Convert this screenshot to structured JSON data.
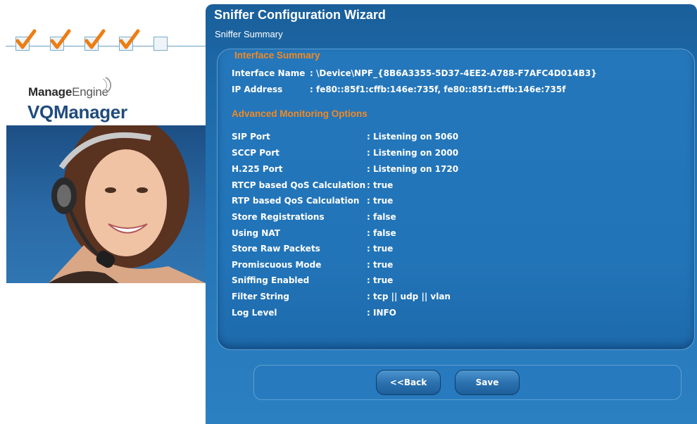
{
  "wizard": {
    "title": "Sniffer Configuration Wizard",
    "subtitle": "Sniffer Summary",
    "steps": [
      {
        "state": "completed",
        "icon": "checkmark-icon"
      },
      {
        "state": "completed",
        "icon": "checkmark-icon"
      },
      {
        "state": "completed",
        "icon": "checkmark-icon"
      },
      {
        "state": "completed",
        "icon": "checkmark-icon"
      },
      {
        "state": "current",
        "icon": "empty-box-icon"
      }
    ]
  },
  "brand": {
    "company_bold": "Manage",
    "company_light": "Engine",
    "product": "VQManager"
  },
  "interface_summary": {
    "heading": "Interface Summary",
    "rows": [
      {
        "label": "Interface Name",
        "value": ": \\Device\\NPF_{8B6A3355-5D37-4EE2-A788-F7AFC4D014B3}"
      },
      {
        "label": "IP Address",
        "value": ": fe80::85f1:cffb:146e:735f, fe80::85f1:cffb:146e:735f"
      }
    ]
  },
  "advanced_options": {
    "heading": "Advanced Monitoring Options",
    "rows": [
      {
        "label": "SIP Port",
        "value": ": Listening on 5060"
      },
      {
        "label": "SCCP Port",
        "value": ": Listening on 2000"
      },
      {
        "label": "H.225 Port",
        "value": ": Listening on 1720"
      },
      {
        "label": "RTCP based QoS Calculation",
        "value": ": true"
      },
      {
        "label": "RTP based QoS Calculation",
        "value": ": true"
      },
      {
        "label": "Store Registrations",
        "value": ": false"
      },
      {
        "label": "Using NAT",
        "value": ": false"
      },
      {
        "label": "Store Raw Packets",
        "value": ": true"
      },
      {
        "label": "Promiscuous Mode",
        "value": ": true"
      },
      {
        "label": "Sniffing Enabled",
        "value": ": true"
      },
      {
        "label": "Filter String",
        "value": ": tcp || udp || vlan"
      },
      {
        "label": "Log Level",
        "value": ": INFO"
      }
    ]
  },
  "buttons": {
    "back": "<<Back",
    "save": "Save"
  },
  "colors": {
    "panel_blue": "#1f6cab",
    "heading_orange": "#f08a24",
    "check_orange": "#ee7d12",
    "product_blue": "#1f4b7c"
  }
}
